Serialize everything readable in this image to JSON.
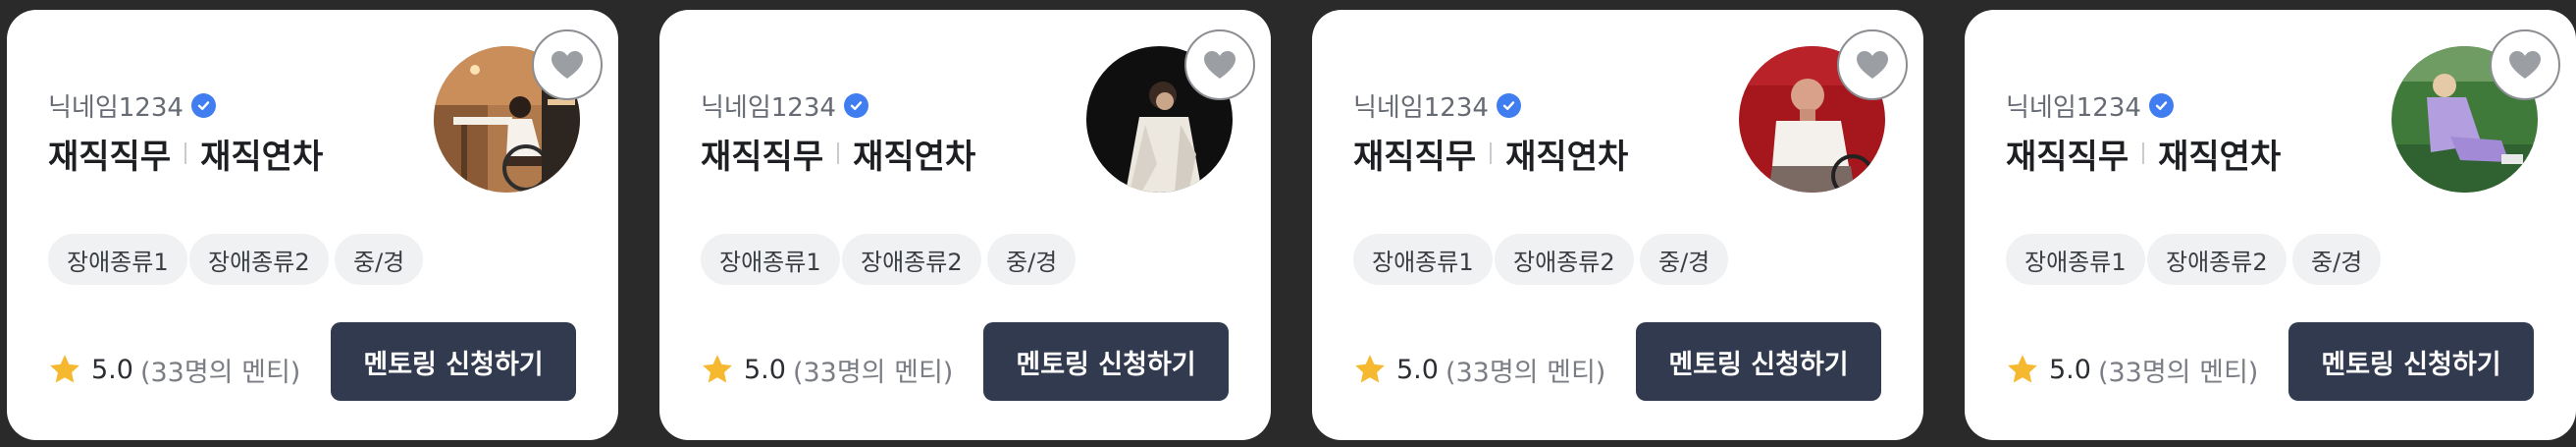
{
  "colors": {
    "page_background": "#2a2a2b",
    "card_background": "#ffffff",
    "verified_badge": "#3f7df0",
    "star": "#f5b82e",
    "apply_button": "#323a4f"
  },
  "cards": [
    {
      "nickname": "닉네임1234",
      "verified_icon": "verified-badge-icon",
      "job_title": "재직직무",
      "job_years": "재직연차",
      "tags": [
        "장애종류1",
        "장애종류2",
        "중/경"
      ],
      "rating": "5.0",
      "mentee_count": "(33명의 멘티)",
      "apply_label": "멘토링 신청하기",
      "favorite_icon": "heart-icon",
      "rating_icon": "star-icon",
      "avatar": "mentor-photo-wheelchair-desk"
    },
    {
      "nickname": "닉네임1234",
      "verified_icon": "verified-badge-icon",
      "job_title": "재직직무",
      "job_years": "재직연차",
      "tags": [
        "장애종류1",
        "장애종류2",
        "중/경"
      ],
      "rating": "5.0",
      "mentee_count": "(33명의 멘티)",
      "apply_label": "멘토링 신청하기",
      "favorite_icon": "heart-icon",
      "rating_icon": "star-icon",
      "avatar": "mentor-photo-dark-background"
    },
    {
      "nickname": "닉네임1234",
      "verified_icon": "verified-badge-icon",
      "job_title": "재직직무",
      "job_years": "재직연차",
      "tags": [
        "장애종류1",
        "장애종류2",
        "중/경"
      ],
      "rating": "5.0",
      "mentee_count": "(33명의 멘티)",
      "apply_label": "멘토링 신청하기",
      "favorite_icon": "heart-icon",
      "rating_icon": "star-icon",
      "avatar": "mentor-photo-red-background"
    },
    {
      "nickname": "닉네임1234",
      "verified_icon": "verified-badge-icon",
      "job_title": "재직직무",
      "job_years": "재직연차",
      "tags": [
        "장애종류1",
        "장애종류2",
        "중/경"
      ],
      "rating": "5.0",
      "mentee_count": "(33명의 멘티)",
      "apply_label": "멘토링 신청하기",
      "favorite_icon": "heart-icon",
      "rating_icon": "star-icon",
      "avatar": "mentor-photo-outdoor-grass"
    }
  ]
}
